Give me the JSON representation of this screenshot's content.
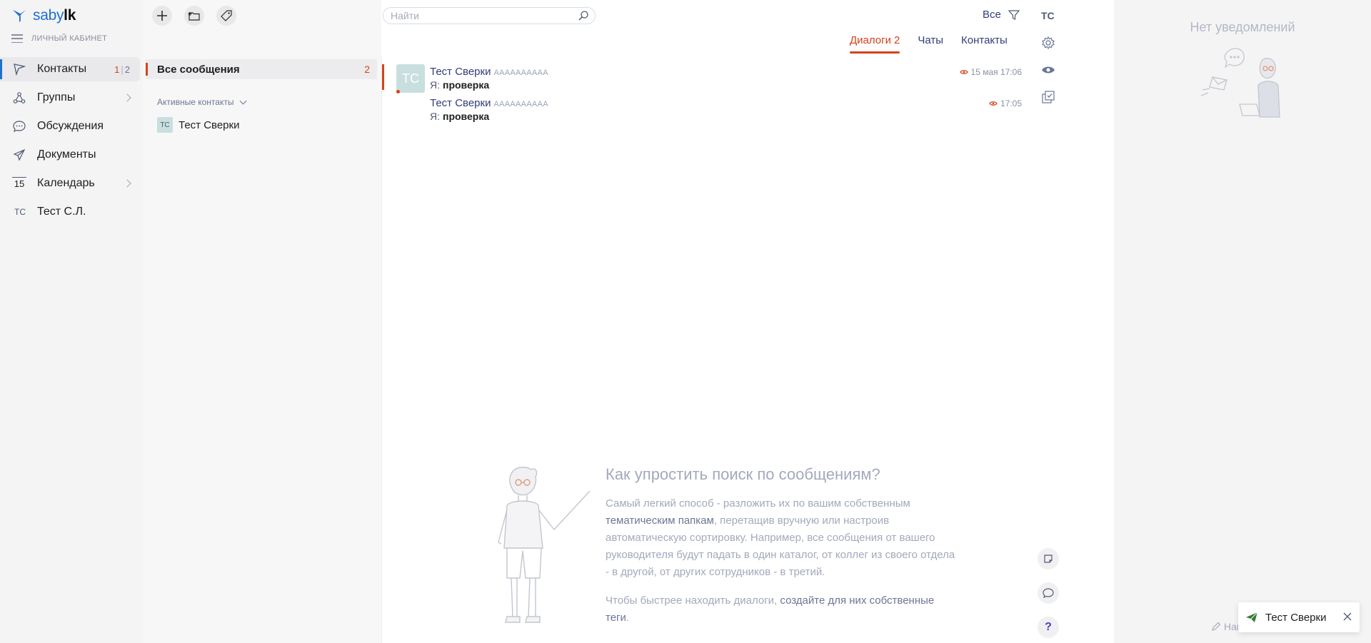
{
  "brand": {
    "logo_main": "saby",
    "logo_bold": "lk",
    "cabinet_label": "ЛИЧНЫЙ КАБИНЕТ"
  },
  "sidebar": {
    "items": [
      {
        "label": "Контакты",
        "counter_unread": "1",
        "counter_total": "2",
        "icon": "paper-plane-icon"
      },
      {
        "label": "Группы",
        "icon": "group-nodes-icon"
      },
      {
        "label": "Обсуждения",
        "icon": "chat-bubble-icon"
      },
      {
        "label": "Документы",
        "icon": "send-icon"
      },
      {
        "label": "Календарь",
        "icon": "calendar-icon",
        "icon_text": "15"
      },
      {
        "label": "Тест С.Л.",
        "icon": "avatar-initials",
        "icon_text": "ТС"
      }
    ]
  },
  "folders": {
    "all_messages": "Все сообщения",
    "all_messages_count": "2",
    "active_contacts_label": "Активные контакты",
    "contacts": [
      {
        "initials": "ТС",
        "name": "Тест Сверки"
      }
    ]
  },
  "search": {
    "placeholder": "Найти"
  },
  "filter": {
    "label": "Все"
  },
  "user_initials": "ТС",
  "tabs": [
    {
      "label": "Диалоги",
      "count": "2",
      "active": true
    },
    {
      "label": "Чаты"
    },
    {
      "label": "Контакты"
    }
  ],
  "messages": [
    {
      "avatar_initials": "ТС",
      "sender": "Тест Сверки",
      "sender_sub": "АААААААААА",
      "prefix": "Я:",
      "text": "проверка",
      "time": "15 мая 17:06"
    },
    {
      "sender": "Тест Сверки",
      "sender_sub": "АААААААААА",
      "prefix": "Я:",
      "text": "проверка",
      "time": "17:05"
    }
  ],
  "tip": {
    "title": "Как упростить поиск по сообщениям?",
    "p1_a": "Самый легкий способ - разложить их по вашим собственным ",
    "p1_link": "тематическим папкам",
    "p1_b": ", перетащив вручную или настроив автоматическую сортировку. Например, все сообщения от вашего руководителя будут падать в один каталог, от коллег из своего отдела - в другой, от других сотрудников - в третий.",
    "p2_a": "Чтобы быстрее находить диалоги, ",
    "p2_link": "создайте для них собственные теги",
    "p2_b": "."
  },
  "notifications": {
    "empty_text": "Нет уведомлений",
    "write_label": "Напи"
  },
  "toast": {
    "name": "Тест Сверки"
  },
  "colors": {
    "accent": "#d4431a",
    "brand_blue": "#1f6fd0",
    "text_primary": "#313e78",
    "toast_green": "#2e7d32"
  }
}
